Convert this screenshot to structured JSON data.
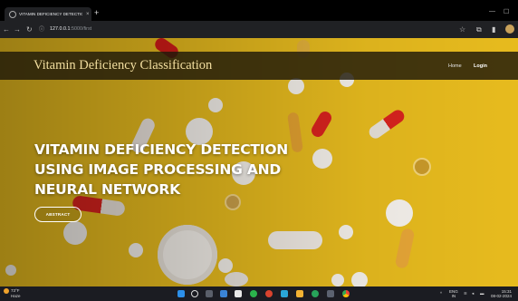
{
  "browser": {
    "tab_title": "VITAMIN DEFICIENCY DETECTIO",
    "tab_close": "×",
    "new_tab": "+",
    "url_host": "127.0.0.1",
    "url_path": ":5000/first",
    "win_min": "—",
    "win_max": "☐"
  },
  "site": {
    "brand": "Vitamin Deficiency Classification",
    "nav": {
      "home": "Home",
      "login": "Login"
    },
    "hero_lines": [
      "VITAMIN DEFICIENCY DETECTION",
      "USING IMAGE PROCESSING AND",
      "NEURAL NETWORK"
    ],
    "abstract_button": "ABSTRACT"
  },
  "taskbar": {
    "temp": "73°F",
    "weather_text": "Haze",
    "lang_line1": "ENG",
    "lang_line2": "IN",
    "time": "15:31",
    "date": "08-02-2024"
  },
  "colors": {
    "page_bg": "#e7bb1e",
    "nav_strip": "#1e180a",
    "brand_text": "#f3dfa0",
    "accent_red": "#d8231e"
  }
}
